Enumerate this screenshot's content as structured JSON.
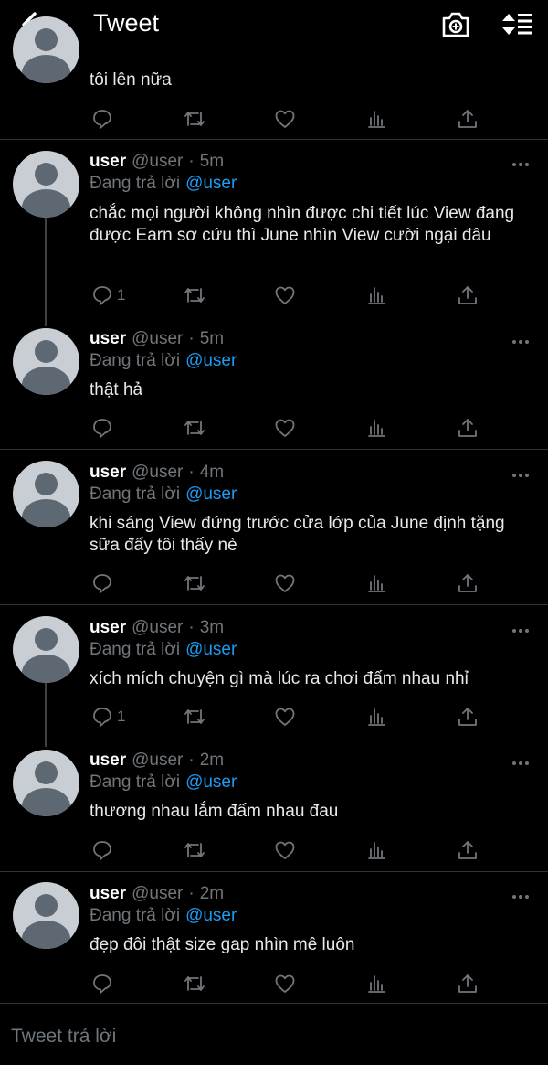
{
  "header": {
    "title": "Tweet",
    "back_icon": "chevron-left-icon",
    "camera_icon": "camera-icon",
    "sort_icon": "sort-icon"
  },
  "tweets": [
    {
      "text": "tôi lên nữa",
      "reply_count": ""
    },
    {
      "name": "user",
      "handle": "@user",
      "time": "5m",
      "reply_prefix": "Đang trả lời",
      "reply_to": "@user",
      "text": "chắc mọi người không nhìn được chi tiết lúc View đang được Earn sơ cứu thì June nhìn View cười ngại đâu",
      "reply_count": "1"
    },
    {
      "name": "user",
      "handle": "@user",
      "time": "5m",
      "reply_prefix": "Đang trả lời",
      "reply_to": "@user",
      "text": "thật hả",
      "reply_count": ""
    },
    {
      "name": "user",
      "handle": "@user",
      "time": "4m",
      "reply_prefix": "Đang trả lời",
      "reply_to": "@user",
      "text": "khi sáng View đứng trước cửa lớp của June định tặng sữa đấy tôi thấy nè",
      "reply_count": ""
    },
    {
      "name": "user",
      "handle": "@user",
      "time": "3m",
      "reply_prefix": "Đang trả lời",
      "reply_to": "@user",
      "text": "xích mích chuyện gì mà lúc ra chơi đấm nhau nhỉ",
      "reply_count": "1"
    },
    {
      "name": "user",
      "handle": "@user",
      "time": "2m",
      "reply_prefix": "Đang trả lời",
      "reply_to": "@user",
      "text": "thương nhau lắm đấm nhau đau",
      "reply_count": ""
    },
    {
      "name": "user",
      "handle": "@user",
      "time": "2m",
      "reply_prefix": "Đang trả lời",
      "reply_to": "@user",
      "text": "đẹp đôi thật size gap nhìn mê luôn",
      "reply_count": ""
    }
  ],
  "compose": {
    "placeholder": "Tweet trả lời"
  },
  "colors": {
    "background": "#000000",
    "link": "#1d9bf0",
    "muted": "#71767b"
  }
}
